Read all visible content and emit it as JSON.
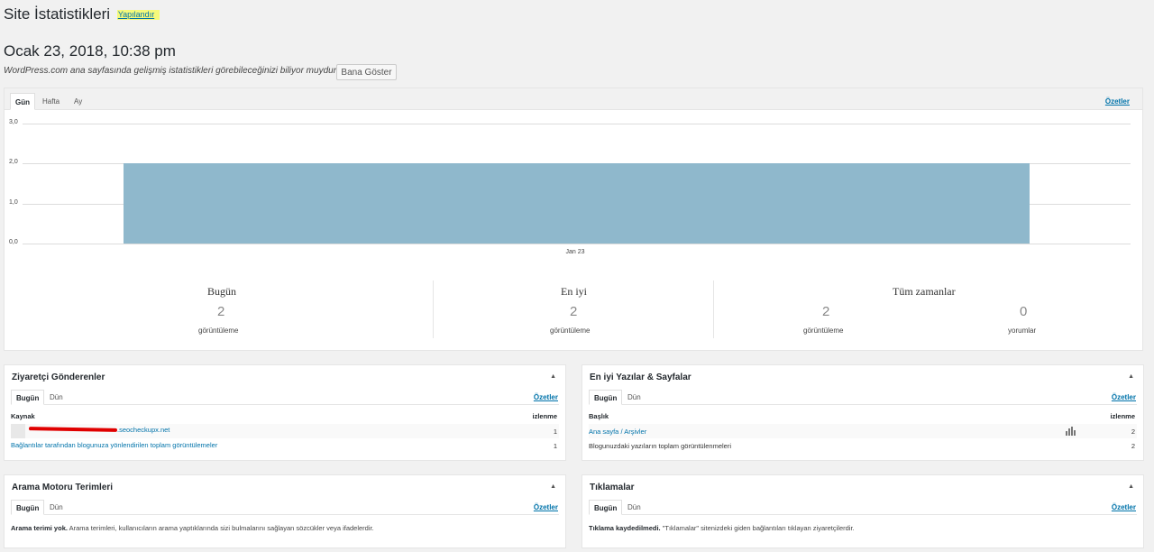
{
  "header": {
    "title": "Site İstatistikleri",
    "configure_label": "Yapılandır",
    "date": "Ocak 23, 2018, 10:38 pm",
    "notice_text": "WordPress.com ana sayfasında gelişmiş istatistikleri görebileceğinizi biliyor muydunuz?",
    "notice_button": "Bana Göster"
  },
  "stats": {
    "tabs": [
      "Gün",
      "Hafta",
      "Ay"
    ],
    "active_tab": "Gün",
    "summary_link": "Özetler",
    "chart_data": {
      "type": "bar",
      "categories": [
        "Jan 23"
      ],
      "values": [
        2
      ],
      "ylim": [
        0,
        3
      ],
      "yticks": [
        "0,0",
        "1,0",
        "2,0",
        "3,0"
      ],
      "grid": true
    },
    "summary": {
      "today": {
        "title": "Bugün",
        "value": "2",
        "label": "görüntüleme"
      },
      "best": {
        "title": "En iyi",
        "value": "2",
        "label": "görüntüleme"
      },
      "all_time": {
        "title": "Tüm zamanlar",
        "views_value": "2",
        "views_label": "görüntüleme",
        "comments_value": "0",
        "comments_label": "yorumlar"
      }
    }
  },
  "referrers": {
    "title": "Ziyaretçi Gönderenler",
    "tabs": [
      "Bugün",
      "Dün"
    ],
    "summary_link": "Özetler",
    "col_source": "Kaynak",
    "col_views": "izlenme",
    "rows": [
      {
        "label": ".seocheckupx.net",
        "count": "1"
      },
      {
        "label": "Bağlantılar tarafından blogunuza yönlendirilen toplam görüntülemeler",
        "count": "1"
      }
    ]
  },
  "top_posts": {
    "title": "En iyi Yazılar & Sayfalar",
    "tabs": [
      "Bugün",
      "Dün"
    ],
    "summary_link": "Özetler",
    "col_title": "Başlık",
    "col_views": "izlenme",
    "rows": [
      {
        "label": "Ana sayfa / Arşivler",
        "count": "2"
      },
      {
        "label": "Blogunuzdaki yazıların toplam görüntülenmeleri",
        "count": "2"
      }
    ]
  },
  "search_terms": {
    "title": "Arama Motoru Terimleri",
    "tabs": [
      "Bugün",
      "Dün"
    ],
    "summary_link": "Özetler",
    "empty_bold": "Arama terimi yok.",
    "empty_text": "Arama terimleri, kullanıcıların arama yaptıklarında sizi bulmalarını sağlayan sözcükler veya ifadelerdir."
  },
  "clicks": {
    "title": "Tıklamalar",
    "tabs": [
      "Bugün",
      "Dün"
    ],
    "summary_link": "Özetler",
    "empty_bold": "Tıklama kaydedilmedi.",
    "empty_text": "\"Tıklamalar\" sitenizdeki giden bağlantıları tıklayan ziyaretçilerdir."
  },
  "colors": {
    "bar": "#8fb8cc",
    "link": "#0073aa",
    "redaction": "#e00000",
    "highlight": "#f5f97a"
  }
}
